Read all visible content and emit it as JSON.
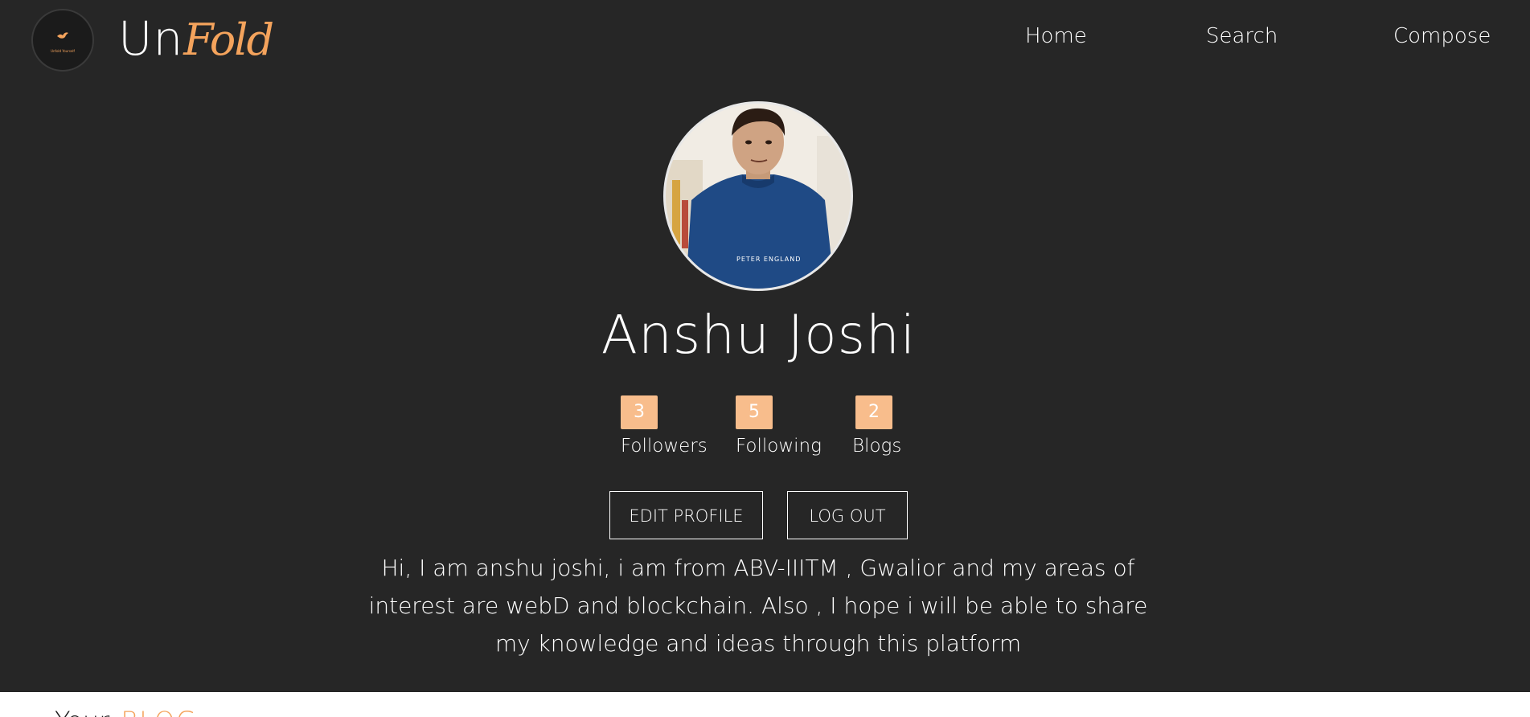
{
  "navbar": {
    "logo_tagline": "Unfold Yourself",
    "brand_plain": "Un",
    "brand_script": "Fold",
    "links": {
      "home": "Home",
      "search": "Search",
      "compose": "Compose"
    }
  },
  "profile": {
    "name": "Anshu Joshi",
    "avatar_shirt_text": "PETER ENGLAND",
    "stats": {
      "followers": {
        "count": "3",
        "label": "Followers"
      },
      "following": {
        "count": "5",
        "label": "Following"
      },
      "blogs": {
        "count": "2",
        "label": "Blogs"
      }
    },
    "buttons": {
      "edit": "EDIT PROFILE",
      "logout": "LOG OUT"
    },
    "bio": "Hi, I am anshu joshi, i am from ABV-IIITM , Gwalior and my areas of interest are webD and blockchain. Also , I hope i will be able to share my knowledge and ideas through this platform"
  },
  "blog_section": {
    "heading_plain": "Your",
    "heading_accent": "BLOG"
  },
  "colors": {
    "background": "#262626",
    "accent": "#f4a35c",
    "stat_badge": "#f8bd8c",
    "text": "#ffffff"
  }
}
